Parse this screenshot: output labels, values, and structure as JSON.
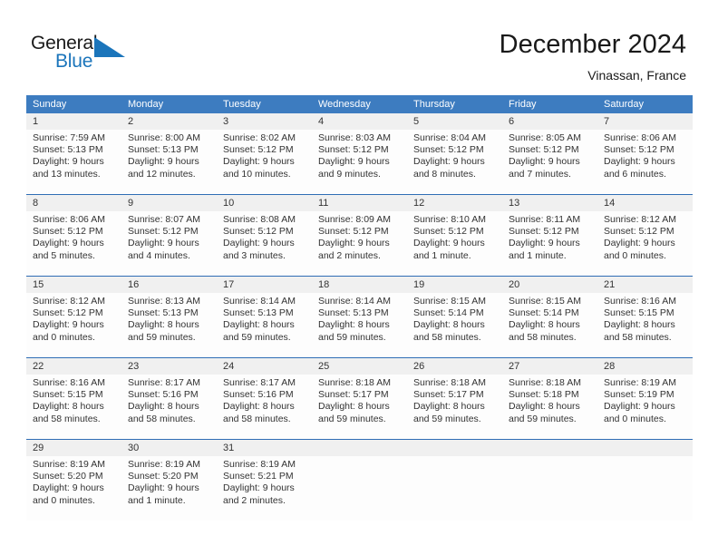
{
  "logo": {
    "word1": "General",
    "word2": "Blue",
    "triangle_color": "#1b75bb",
    "icon": "triangle-icon"
  },
  "header": {
    "title": "December 2024",
    "subtitle": "Vinassan, France"
  },
  "theme": {
    "header_blue": "#3d7cc0",
    "row_divider_blue": "#2f6db5",
    "daynum_band": "#f0f0f0",
    "text": "#333333"
  },
  "calendar": {
    "day_headers": [
      "Sunday",
      "Monday",
      "Tuesday",
      "Wednesday",
      "Thursday",
      "Friday",
      "Saturday"
    ],
    "weeks": [
      [
        {
          "day": "1",
          "sunrise": "Sunrise: 7:59 AM",
          "sunset": "Sunset: 5:13 PM",
          "daylight": "Daylight: 9 hours and 13 minutes."
        },
        {
          "day": "2",
          "sunrise": "Sunrise: 8:00 AM",
          "sunset": "Sunset: 5:13 PM",
          "daylight": "Daylight: 9 hours and 12 minutes."
        },
        {
          "day": "3",
          "sunrise": "Sunrise: 8:02 AM",
          "sunset": "Sunset: 5:12 PM",
          "daylight": "Daylight: 9 hours and 10 minutes."
        },
        {
          "day": "4",
          "sunrise": "Sunrise: 8:03 AM",
          "sunset": "Sunset: 5:12 PM",
          "daylight": "Daylight: 9 hours and 9 minutes."
        },
        {
          "day": "5",
          "sunrise": "Sunrise: 8:04 AM",
          "sunset": "Sunset: 5:12 PM",
          "daylight": "Daylight: 9 hours and 8 minutes."
        },
        {
          "day": "6",
          "sunrise": "Sunrise: 8:05 AM",
          "sunset": "Sunset: 5:12 PM",
          "daylight": "Daylight: 9 hours and 7 minutes."
        },
        {
          "day": "7",
          "sunrise": "Sunrise: 8:06 AM",
          "sunset": "Sunset: 5:12 PM",
          "daylight": "Daylight: 9 hours and 6 minutes."
        }
      ],
      [
        {
          "day": "8",
          "sunrise": "Sunrise: 8:06 AM",
          "sunset": "Sunset: 5:12 PM",
          "daylight": "Daylight: 9 hours and 5 minutes."
        },
        {
          "day": "9",
          "sunrise": "Sunrise: 8:07 AM",
          "sunset": "Sunset: 5:12 PM",
          "daylight": "Daylight: 9 hours and 4 minutes."
        },
        {
          "day": "10",
          "sunrise": "Sunrise: 8:08 AM",
          "sunset": "Sunset: 5:12 PM",
          "daylight": "Daylight: 9 hours and 3 minutes."
        },
        {
          "day": "11",
          "sunrise": "Sunrise: 8:09 AM",
          "sunset": "Sunset: 5:12 PM",
          "daylight": "Daylight: 9 hours and 2 minutes."
        },
        {
          "day": "12",
          "sunrise": "Sunrise: 8:10 AM",
          "sunset": "Sunset: 5:12 PM",
          "daylight": "Daylight: 9 hours and 1 minute."
        },
        {
          "day": "13",
          "sunrise": "Sunrise: 8:11 AM",
          "sunset": "Sunset: 5:12 PM",
          "daylight": "Daylight: 9 hours and 1 minute."
        },
        {
          "day": "14",
          "sunrise": "Sunrise: 8:12 AM",
          "sunset": "Sunset: 5:12 PM",
          "daylight": "Daylight: 9 hours and 0 minutes."
        }
      ],
      [
        {
          "day": "15",
          "sunrise": "Sunrise: 8:12 AM",
          "sunset": "Sunset: 5:12 PM",
          "daylight": "Daylight: 9 hours and 0 minutes."
        },
        {
          "day": "16",
          "sunrise": "Sunrise: 8:13 AM",
          "sunset": "Sunset: 5:13 PM",
          "daylight": "Daylight: 8 hours and 59 minutes."
        },
        {
          "day": "17",
          "sunrise": "Sunrise: 8:14 AM",
          "sunset": "Sunset: 5:13 PM",
          "daylight": "Daylight: 8 hours and 59 minutes."
        },
        {
          "day": "18",
          "sunrise": "Sunrise: 8:14 AM",
          "sunset": "Sunset: 5:13 PM",
          "daylight": "Daylight: 8 hours and 59 minutes."
        },
        {
          "day": "19",
          "sunrise": "Sunrise: 8:15 AM",
          "sunset": "Sunset: 5:14 PM",
          "daylight": "Daylight: 8 hours and 58 minutes."
        },
        {
          "day": "20",
          "sunrise": "Sunrise: 8:15 AM",
          "sunset": "Sunset: 5:14 PM",
          "daylight": "Daylight: 8 hours and 58 minutes."
        },
        {
          "day": "21",
          "sunrise": "Sunrise: 8:16 AM",
          "sunset": "Sunset: 5:15 PM",
          "daylight": "Daylight: 8 hours and 58 minutes."
        }
      ],
      [
        {
          "day": "22",
          "sunrise": "Sunrise: 8:16 AM",
          "sunset": "Sunset: 5:15 PM",
          "daylight": "Daylight: 8 hours and 58 minutes."
        },
        {
          "day": "23",
          "sunrise": "Sunrise: 8:17 AM",
          "sunset": "Sunset: 5:16 PM",
          "daylight": "Daylight: 8 hours and 58 minutes."
        },
        {
          "day": "24",
          "sunrise": "Sunrise: 8:17 AM",
          "sunset": "Sunset: 5:16 PM",
          "daylight": "Daylight: 8 hours and 58 minutes."
        },
        {
          "day": "25",
          "sunrise": "Sunrise: 8:18 AM",
          "sunset": "Sunset: 5:17 PM",
          "daylight": "Daylight: 8 hours and 59 minutes."
        },
        {
          "day": "26",
          "sunrise": "Sunrise: 8:18 AM",
          "sunset": "Sunset: 5:17 PM",
          "daylight": "Daylight: 8 hours and 59 minutes."
        },
        {
          "day": "27",
          "sunrise": "Sunrise: 8:18 AM",
          "sunset": "Sunset: 5:18 PM",
          "daylight": "Daylight: 8 hours and 59 minutes."
        },
        {
          "day": "28",
          "sunrise": "Sunrise: 8:19 AM",
          "sunset": "Sunset: 5:19 PM",
          "daylight": "Daylight: 9 hours and 0 minutes."
        }
      ],
      [
        {
          "day": "29",
          "sunrise": "Sunrise: 8:19 AM",
          "sunset": "Sunset: 5:20 PM",
          "daylight": "Daylight: 9 hours and 0 minutes."
        },
        {
          "day": "30",
          "sunrise": "Sunrise: 8:19 AM",
          "sunset": "Sunset: 5:20 PM",
          "daylight": "Daylight: 9 hours and 1 minute."
        },
        {
          "day": "31",
          "sunrise": "Sunrise: 8:19 AM",
          "sunset": "Sunset: 5:21 PM",
          "daylight": "Daylight: 9 hours and 2 minutes."
        },
        {
          "day": "",
          "sunrise": "",
          "sunset": "",
          "daylight": ""
        },
        {
          "day": "",
          "sunrise": "",
          "sunset": "",
          "daylight": ""
        },
        {
          "day": "",
          "sunrise": "",
          "sunset": "",
          "daylight": ""
        },
        {
          "day": "",
          "sunrise": "",
          "sunset": "",
          "daylight": ""
        }
      ]
    ]
  }
}
